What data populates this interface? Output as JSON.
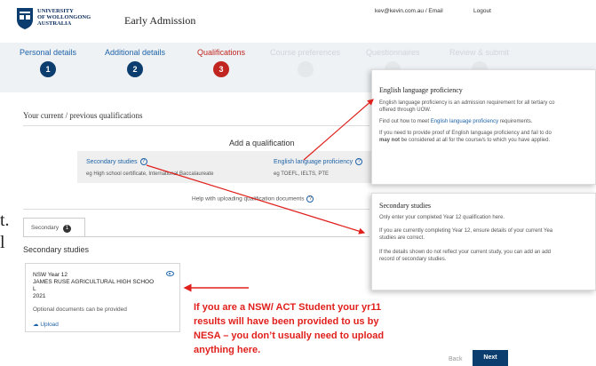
{
  "header": {
    "logo_lines": [
      "UNIVERSITY",
      "OF WOLLONGONG",
      "AUSTRALIA"
    ],
    "title": "Early Admission",
    "user_email": "kev@kevin.com.au / Email",
    "logout": "Logout"
  },
  "steps": [
    {
      "label": "Personal details",
      "num": "1",
      "state": "done"
    },
    {
      "label": "Additional details",
      "num": "2",
      "state": "done"
    },
    {
      "label": "Qualifications",
      "num": "3",
      "state": "active"
    },
    {
      "label": "Course preferences",
      "num": "4",
      "state": "todo"
    },
    {
      "label": "Questionnaires",
      "num": "5",
      "state": "todo"
    },
    {
      "label": "Review & submit",
      "num": "6",
      "state": "todo"
    }
  ],
  "main": {
    "section_title": "Your current / previous qualifications",
    "add_qualification": "Add a qualification",
    "option1_title": "Secondary studies",
    "option1_sub": "eg High school certificate, International Baccalaureate",
    "option2_title": "English language proficiency",
    "option2_sub": "eg TOEFL, IELTS, PTE",
    "help_link": "Help with uploading qualification documents",
    "tab_label": "Secondary",
    "tab_count": "1",
    "sub_title": "Secondary studies",
    "cut_text_1": "t.",
    "cut_text_2": "l"
  },
  "card": {
    "title": "NSW Year 12",
    "school": "JAMES RUSE AGRICULTURAL HIGH SCHOO",
    "school_cont": "L",
    "year": "2021",
    "optional": "Optional documents can be provided",
    "upload": "Upload"
  },
  "annotation": {
    "lines": [
      "If you are a NSW/ ACT Student your yr11",
      "results will have been provided to us by",
      "NESA – you don’t usually need to upload",
      "anything here."
    ]
  },
  "nav": {
    "back": "Back",
    "next": "Next"
  },
  "panel_english": {
    "title": "English language proficiency",
    "p1a": "English language proficiency is an admission requirement for all tertiary co",
    "p1b": "offered through UOW.",
    "p2_pre": "Find out how to meet ",
    "p2_link": "English language proficiency",
    "p2_post": " requirements.",
    "p3a": "If you need to provide proof of English language proficiency and fail to do",
    "p3b_bold": "may not",
    "p3b_rest": " be considered at all for the course/s to which you have applied."
  },
  "panel_secondary": {
    "title": "Secondary studies",
    "p1": "Only enter your completed Year 12 qualification here.",
    "p2a": "If you are currently completing Year 12, ensure details of your current Yea",
    "p2b": "studies are correct.",
    "p3a": "If the details shown do not reflect your current study, you can add an add",
    "p3b": "record of secondary studies."
  },
  "colors": {
    "brand_navy": "#0b3d6e",
    "active_red": "#c0261f",
    "link_blue": "#1f63a8",
    "annotation_red": "#e0201c"
  }
}
